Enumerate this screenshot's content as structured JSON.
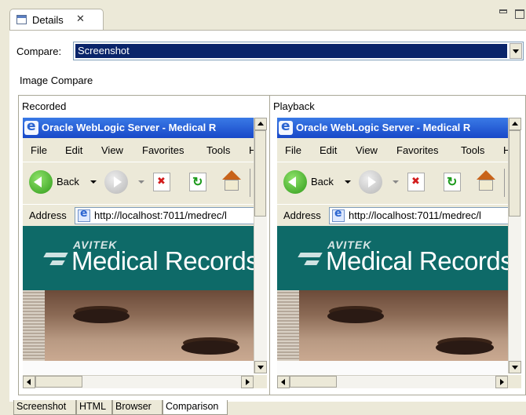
{
  "view": {
    "tab_title": "Details",
    "close_glyph": "✕"
  },
  "compare": {
    "label": "Compare:",
    "value": "Screenshot"
  },
  "image_compare_label": "Image Compare",
  "panels": {
    "recorded": {
      "title": "Recorded"
    },
    "playback": {
      "title": "Playback"
    }
  },
  "browser": {
    "title": "Oracle WebLogic Server - Medical R",
    "menu": [
      "File",
      "Edit",
      "View",
      "Favorites",
      "Tools",
      "H"
    ],
    "toolbar": {
      "back_label": "Back"
    },
    "address_label": "Address",
    "url": "http://localhost:7011/medrec/l",
    "page": {
      "brand_small": "AVITEK",
      "brand_large": "Medical Records"
    }
  },
  "bottom_tabs": [
    "Screenshot",
    "HTML",
    "Browser",
    "Comparison"
  ],
  "active_tab": "Comparison",
  "icons": {
    "view_tab": "details-view-icon",
    "browser": "internet-explorer-icon",
    "back": "back-arrow-icon",
    "forward": "forward-arrow-icon",
    "stop": "stop-icon",
    "refresh": "refresh-icon",
    "home": "home-icon"
  },
  "colors": {
    "selection": "#0a246a",
    "titlebar": "#2458d6",
    "banner": "#0e6a68",
    "window_bg": "#ece9d8"
  }
}
